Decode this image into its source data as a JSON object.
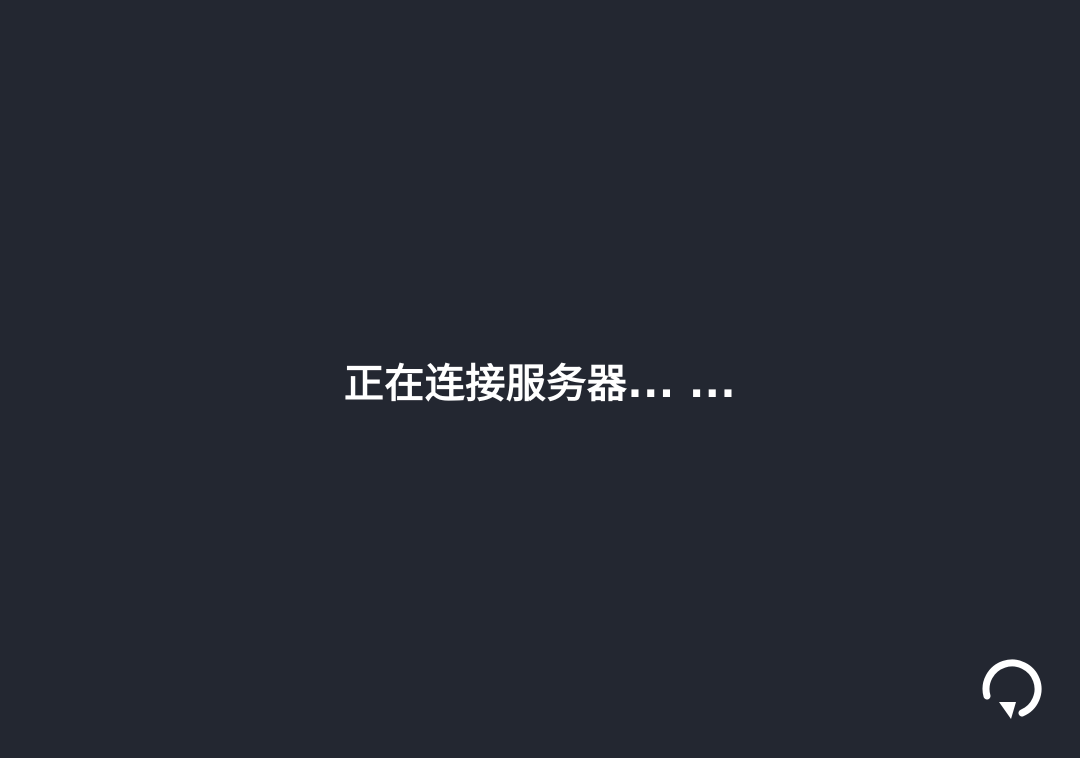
{
  "screen": {
    "background_color": "#232731",
    "status_text": "正在连接服务器... ...",
    "text_color": "#ffffff"
  },
  "refresh": {
    "icon": "refresh-icon",
    "icon_color": "#ffffff"
  }
}
